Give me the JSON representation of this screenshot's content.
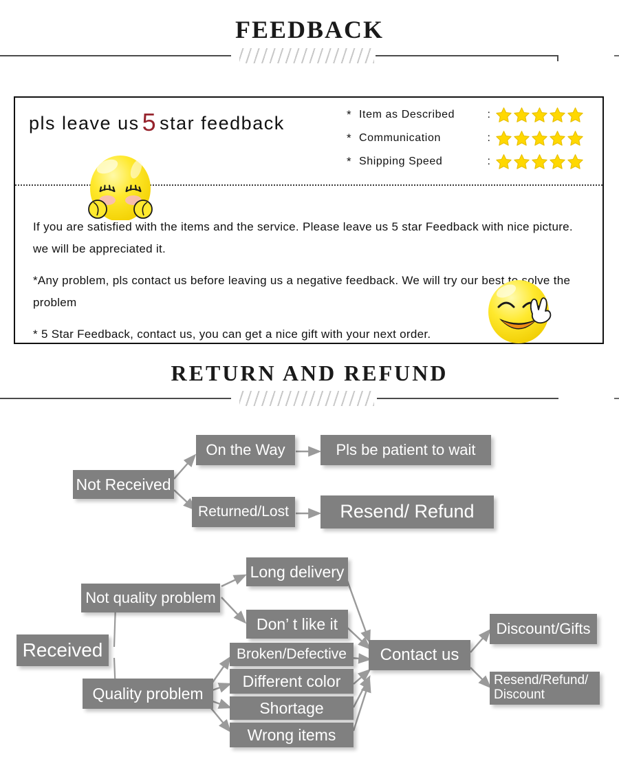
{
  "sections": {
    "feedback_title": "FEEDBACK",
    "return_title": "RETURN  AND  REFUND"
  },
  "feedback": {
    "headline_before": "pls  leave  us",
    "headline_five": "5",
    "headline_after": "star  feedback",
    "ratings": [
      {
        "bullet": "*",
        "label": "Item as Described",
        "colon": ":",
        "stars": 5
      },
      {
        "bullet": "*",
        "label": "Communication",
        "colon": ":",
        "stars": 5
      },
      {
        "bullet": "*",
        "label": "Shipping Speed",
        "colon": ":",
        "stars": 5
      }
    ],
    "body": [
      "If you are satisfied with the items and the service. Please leave us 5 star Feedback with nice picture. we will be appreciated it.",
      "*Any problem, pls contact us before leaving us a negative feedback. We will try our best to solve  the problem",
      "* 5 Star Feedback, contact us, you can get a nice gift with your next order."
    ]
  },
  "flow_not_received": {
    "root": "Not Received",
    "branch_on_the_way": "On the Way",
    "branch_returned_lost": "Returned/Lost",
    "result_wait": "Pls be patient to wait",
    "result_resend_refund": "Resend/ Refund"
  },
  "flow_received": {
    "root": "Received",
    "not_quality": "Not quality problem",
    "quality": "Quality problem",
    "long_delivery": "Long delivery",
    "dont_like": "Don’  t like it",
    "broken": "Broken/Defective",
    "different_color": "Different color",
    "shortage": "Shortage",
    "wrong_items": "Wrong items",
    "contact_us": "Contact us",
    "discount_gifts": "Discount/Gifts",
    "resend_refund_discount": "Resend/Refund/ Discount"
  },
  "colors": {
    "node_gray": "#808080",
    "node_text": "#ffffff",
    "arrow_gray": "#9a9a9a",
    "star_yellow": "#ffd800",
    "star_outline": "#e8c000",
    "accent_red": "#96232c",
    "rule_dark": "#4a4a4a",
    "hatch_gray": "#c8c8c8"
  },
  "icons": {
    "star": "star-icon",
    "shy_face": "shy-smiley-icon",
    "peace_face": "peace-smiley-icon"
  }
}
